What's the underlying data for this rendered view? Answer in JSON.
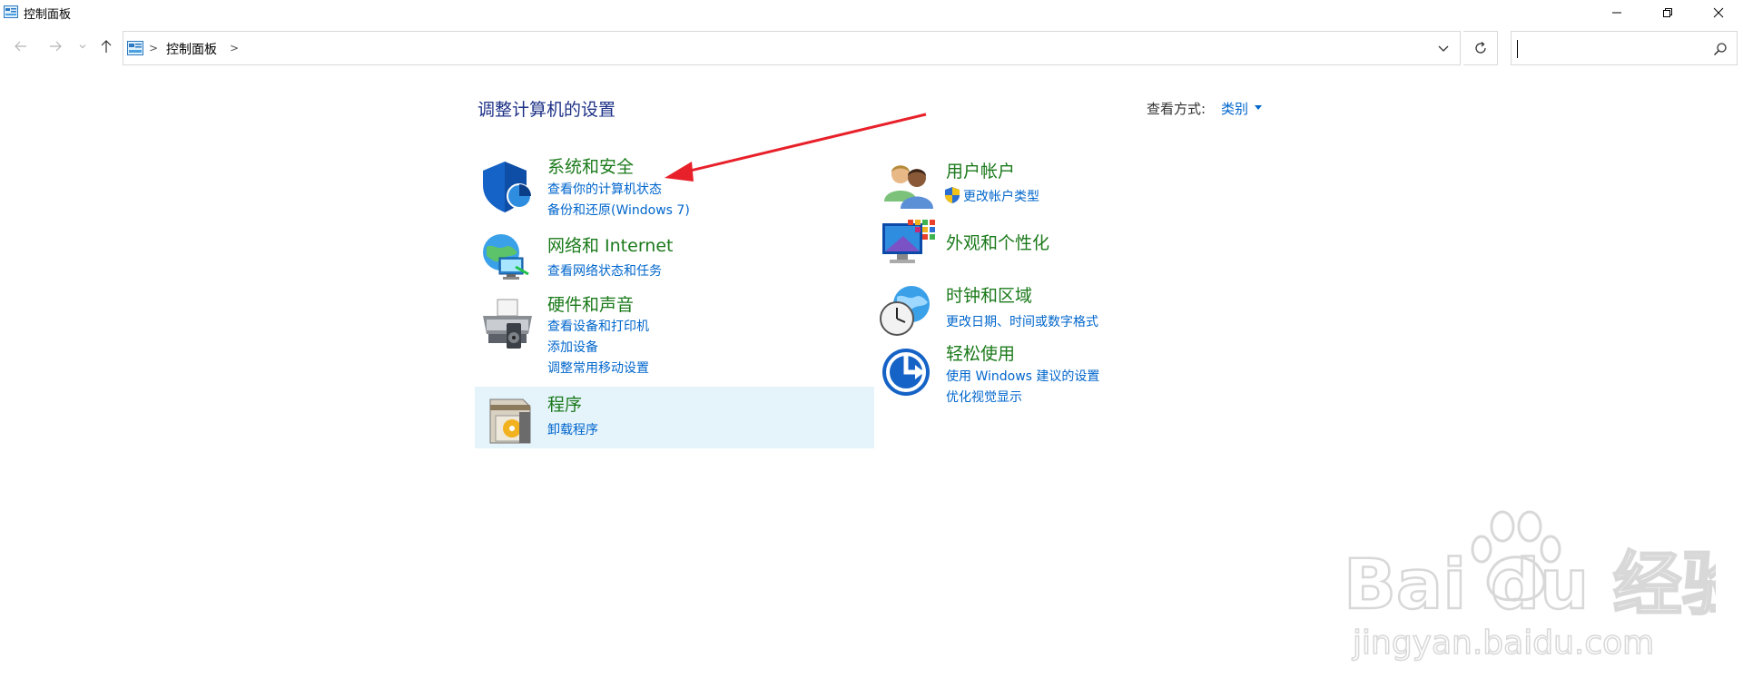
{
  "window": {
    "title": "控制面板"
  },
  "address": {
    "crumb": "控制面板",
    "separator": ">"
  },
  "search": {
    "value": ""
  },
  "content": {
    "heading": "调整计算机的设置",
    "view_by_label": "查看方式:",
    "view_by_value": "类别"
  },
  "categories": {
    "system_security": {
      "title": "系统和安全",
      "links": [
        "查看你的计算机状态",
        "备份和还原(Windows 7)"
      ]
    },
    "network": {
      "title": "网络和 Internet",
      "links": [
        "查看网络状态和任务"
      ]
    },
    "hardware": {
      "title": "硬件和声音",
      "links": [
        "查看设备和打印机",
        "添加设备",
        "调整常用移动设置"
      ]
    },
    "programs": {
      "title": "程序",
      "links": [
        "卸载程序"
      ]
    },
    "user_accounts": {
      "title": "用户帐户",
      "links": [
        "更改帐户类型"
      ]
    },
    "appearance": {
      "title": "外观和个性化",
      "links": []
    },
    "clock": {
      "title": "时钟和区域",
      "links": [
        "更改日期、时间或数字格式"
      ]
    },
    "ease": {
      "title": "轻松使用",
      "links": [
        "使用 Windows 建议的设置",
        "优化视觉显示"
      ]
    }
  },
  "watermark": {
    "brand": "Bai du 经验",
    "url": "jingyan.baidu.com"
  },
  "colors": {
    "heading": "#1e3287",
    "category_title": "#1b7a1b",
    "link": "#0066cc",
    "selected_bg": "#e5f3fb",
    "arrow": "#e8202a"
  }
}
